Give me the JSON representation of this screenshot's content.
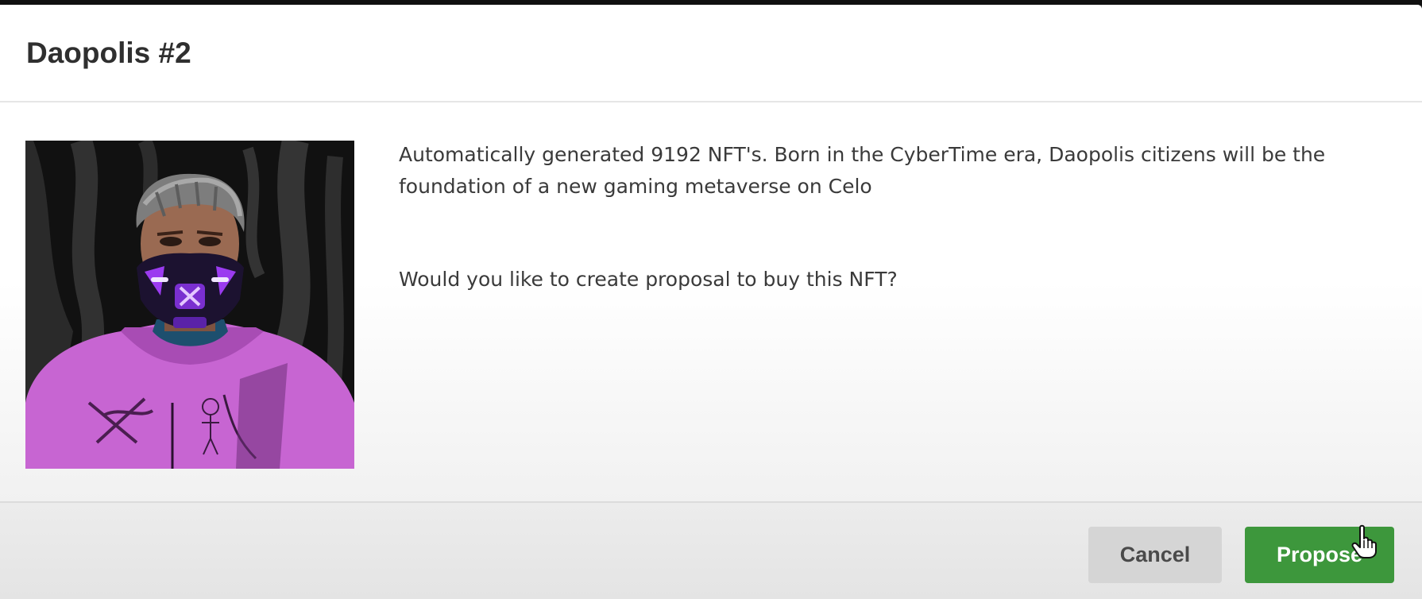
{
  "modal": {
    "title": "Daopolis #2",
    "description": "Automatically generated 9192 NFT's. Born in the CyberTime era, Daopolis citizens will be the foundation of a new gaming metaverse on Celo",
    "question": "Would you like to create proposal to buy this NFT?",
    "image_icon": "nft-character-image"
  },
  "footer": {
    "cancel_label": "Cancel",
    "propose_label": "Propose"
  },
  "colors": {
    "propose_button": "#3d973c",
    "cancel_button": "#d5d5d5",
    "hoodie": "#c765d2",
    "mask_glow": "#9b3bf0"
  },
  "cursor": "hand-pointer-icon"
}
